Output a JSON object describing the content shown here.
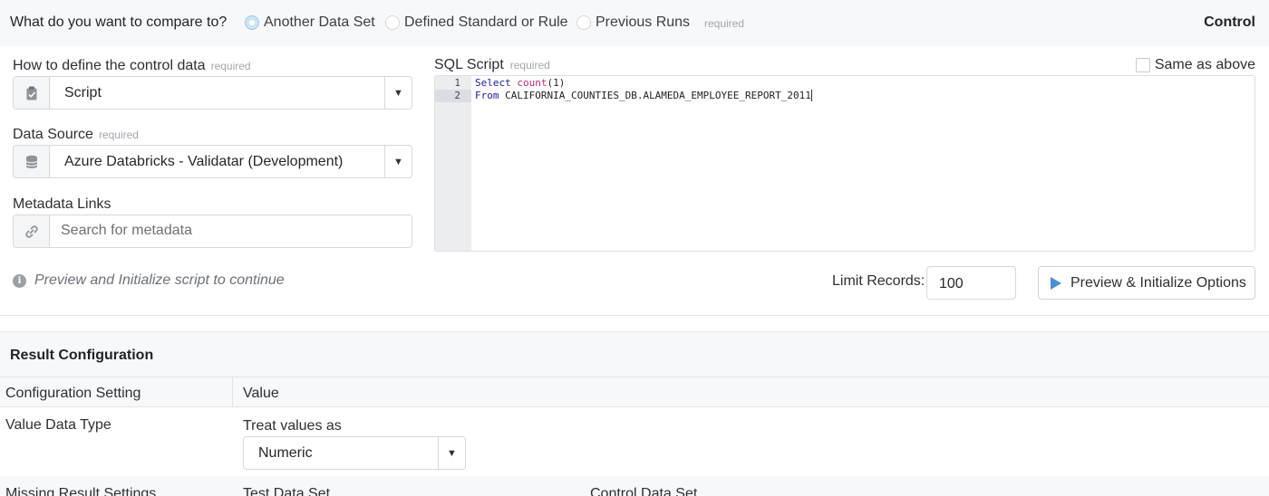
{
  "compare": {
    "question": "What do you want to compare to?",
    "options": [
      {
        "label": "Another Data Set",
        "selected": true
      },
      {
        "label": "Defined Standard or Rule",
        "selected": false
      },
      {
        "label": "Previous Runs",
        "selected": false
      }
    ],
    "required": "required",
    "side_title": "Control"
  },
  "control_data": {
    "label": "How to define the control data",
    "required": "required",
    "value": "Script",
    "icon": "clipboard-icon"
  },
  "data_source": {
    "label": "Data Source",
    "required": "required",
    "value": "Azure Databricks - Validatar (Development)",
    "icon": "database-icon"
  },
  "metadata_links": {
    "label": "Metadata Links",
    "placeholder": "Search for metadata",
    "icon": "link-icon"
  },
  "info": {
    "icon": "info-icon",
    "text": "Preview and Initialize script to continue"
  },
  "sql_script": {
    "label": "SQL Script",
    "required": "required",
    "same_as_above": "Same as above",
    "same_as_above_checked": false,
    "line_numbers": [
      "1",
      "2"
    ],
    "lines": [
      {
        "keyword": "Select",
        "fn": "count",
        "rest": "(1)"
      },
      {
        "keyword": "From",
        "rest": " CALIFORNIA_COUNTIES_DB.ALAMEDA_EMPLOYEE_REPORT_2011"
      }
    ]
  },
  "limit": {
    "label": "Limit Records:",
    "value": "100"
  },
  "preview_button": {
    "label": "Preview & Initialize Options",
    "icon": "play-icon"
  },
  "result_config": {
    "title": "Result Configuration",
    "columns": [
      "Configuration Setting",
      "Value"
    ],
    "value_data_type": {
      "label": "Value Data Type",
      "treat_label": "Treat values as",
      "value": "Numeric"
    },
    "missing_result": {
      "label": "Missing Result Settings",
      "test_label": "Test Data Set",
      "control_label": "Control Data Set"
    }
  },
  "colors": {
    "accent": "#4a8fd6",
    "header_bg": "#f7f8f9",
    "sql_keyword": "#1a1aa6",
    "sql_function": "#c0287a"
  }
}
